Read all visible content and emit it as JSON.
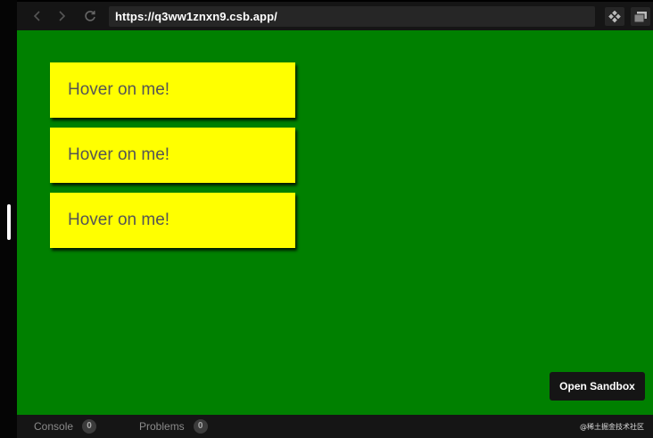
{
  "browser": {
    "url": "https://q3ww1znxn9.csb.app/"
  },
  "preview": {
    "cards": [
      {
        "label": "Hover on me!"
      },
      {
        "label": "Hover on me!"
      },
      {
        "label": "Hover on me!"
      }
    ],
    "open_sandbox_label": "Open Sandbox",
    "background_color": "#008000",
    "card_color": "#ffff00"
  },
  "bottom_bar": {
    "console": {
      "label": "Console",
      "count": "0"
    },
    "problems": {
      "label": "Problems",
      "count": "0"
    },
    "watermark": "@稀土掘金技术社区"
  }
}
